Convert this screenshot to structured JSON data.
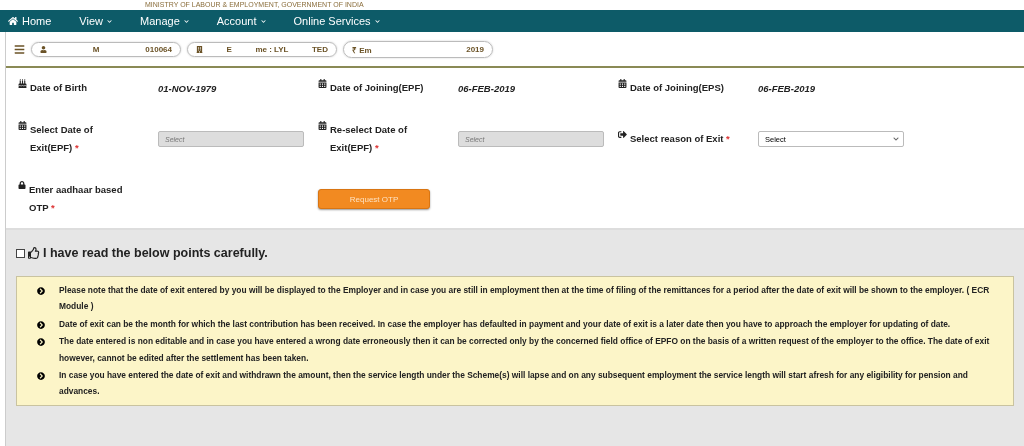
{
  "banner": {
    "text": "MINISTRY OF LABOUR & EMPLOYMENT, GOVERNMENT OF INDIA"
  },
  "nav": [
    {
      "label": "Home",
      "kind": "home"
    },
    {
      "label": "View",
      "kind": "menu"
    },
    {
      "label": "Manage",
      "kind": "menu"
    },
    {
      "label": "Account",
      "kind": "menu"
    },
    {
      "label": "Online Services",
      "kind": "menu"
    }
  ],
  "info_pills": [
    {
      "parts": [
        "M",
        "010064"
      ],
      "kind": "user"
    },
    {
      "parts": [
        "E",
        "me : LYL",
        "TED"
      ],
      "kind": "building"
    },
    {
      "parts": [
        "₹ Em",
        "2019"
      ],
      "kind": "money"
    }
  ],
  "details": [
    {
      "label": "Date of Birth",
      "value": "01-NOV-1979",
      "kind": "birthday"
    },
    {
      "label": "Date of Joining(EPF)",
      "value": "06-FEB-2019",
      "kind": "calendar"
    },
    {
      "label": "Date of Joining(EPS)",
      "value": "06-FEB-2019",
      "kind": "calendar"
    }
  ],
  "exit_fields": [
    {
      "label": "Select Date of Exit(EPF)",
      "required_mark": "*",
      "kind": "date",
      "placeholder": "Select"
    },
    {
      "label": "Re-select Date of Exit(EPF)",
      "required_mark": "*",
      "kind": "date",
      "placeholder": "Select"
    },
    {
      "label": "Select reason of Exit",
      "required_mark": "*",
      "kind": "select",
      "value": "Select"
    }
  ],
  "otp": {
    "label": "Enter aadhaar based OTP",
    "required_mark": "*",
    "button": "Request OTP"
  },
  "acknowledge": {
    "label": "I have read the below points carefully.",
    "checked": false
  },
  "notes": [
    "Please note that the date of exit entered by you will be displayed to the Employer and in case you are still in employment then at the time of filing of the remittances for a period after the date of exit will be shown to the employer. ( ECR Module )",
    "Date of exit can be the month for which the last contribution has been received. In case the employer has defaulted in payment and your date of exit is a later date then you have to approach the employer for updating of date.",
    "The date entered is non editable and in case you have entered a wrong date erroneously then it can be corrected only by the concerned field office of EPFO on the basis of a written request of the employer to the office. The date of exit however, cannot be edited after the settlement has been taken.",
    "In case you have entered the date of exit and withdrawn the amount, then the service length under the Scheme(s) will lapse and on any subsequent employment the service length will start afresh for any eligibility for pension and advances."
  ]
}
